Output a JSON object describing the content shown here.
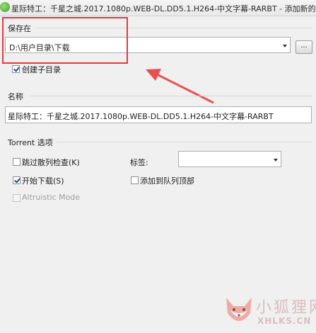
{
  "window": {
    "title": "星际特工：千星之城.2017.1080p.WEB-DL.DD5.1.H264-中文字幕-RARBT - 添加新的 Torre"
  },
  "save_location": {
    "group_label": "保存在",
    "path_value": "D:\\用户目录\\下载",
    "browse_label": "...",
    "create_subfolder_label": "创建子目录",
    "create_subfolder_checked": true
  },
  "name_section": {
    "group_label": "名称",
    "name_value": "星际特工：千星之城.2017.1080p.WEB-DL.DD5.1.H264-中文字幕-RARBT"
  },
  "torrent_options": {
    "group_label": "Torrent 选项",
    "skip_hash_check_label": "跳过散列检查(K)",
    "skip_hash_check_checked": false,
    "start_download_label": "开始下载(S)",
    "start_download_checked": true,
    "altruistic_mode_label": "Altruistic Mode",
    "altruistic_mode_checked": false,
    "tags_label": "标签:",
    "tags_value": "",
    "add_to_top_label": "添加到队列顶部",
    "add_to_top_checked": false
  },
  "annotation": {
    "highlight_color": "#e43a3a"
  },
  "watermark": {
    "text_cn": "小狐狸网",
    "text_en": "XHLKS.CN"
  }
}
